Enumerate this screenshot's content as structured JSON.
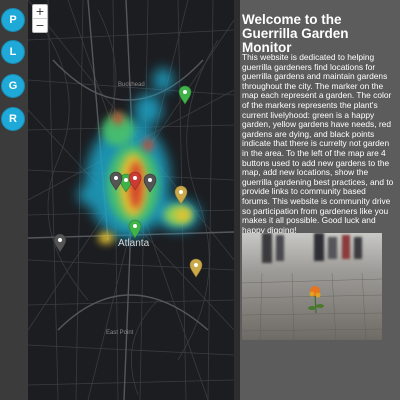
{
  "sidebar": {
    "buttons": [
      {
        "label": "P",
        "action": "add new gardens"
      },
      {
        "label": "L",
        "action": "add new locations"
      },
      {
        "label": "G",
        "action": "guerrilla gardening best practices"
      },
      {
        "label": "R",
        "action": "community based forums"
      }
    ],
    "color": "#1ea9d8"
  },
  "map": {
    "zoom_in_label": "+",
    "zoom_out_label": "−",
    "city_label": "Atlanta",
    "small_labels": [
      "Buckhead",
      "East Point"
    ],
    "markers": [
      {
        "status": "happy",
        "color": "#3fb34a"
      },
      {
        "status": "happy",
        "color": "#3fb34a"
      },
      {
        "status": "happy",
        "color": "#3fb34a"
      },
      {
        "status": "needs",
        "color": "#c9a94a"
      },
      {
        "status": "needs",
        "color": "#c9a94a"
      },
      {
        "status": "dying",
        "color": "#cc3a34"
      },
      {
        "status": "no-garden",
        "color": "#555555"
      },
      {
        "status": "no-garden",
        "color": "#555555"
      },
      {
        "status": "no-garden",
        "color": "#555555"
      }
    ]
  },
  "panel": {
    "title": "Welcome to the Guerrilla Garden Monitor",
    "body": "This website is dedicated to helping guerrilla gardeners find locations for guerrilla gardens and maintain gardens throughout the city. The marker on the map each represent a garden. The color of the markers represents the plant's current livelyhood: green is a happy garden, yellow gardens have needs, red gardens are dying, and black points indicate that there is currelty not garden in the area. To the left of the map are 4 buttons used to add new gardens to the map, add new locations, show the guerrilla gardening best practices, and to provide links to community based forums. This website is community drive so participation from gardeners like you makes it all possible. Good luck and happy digging!",
    "image_alt": "flower growing through pavement crack"
  }
}
